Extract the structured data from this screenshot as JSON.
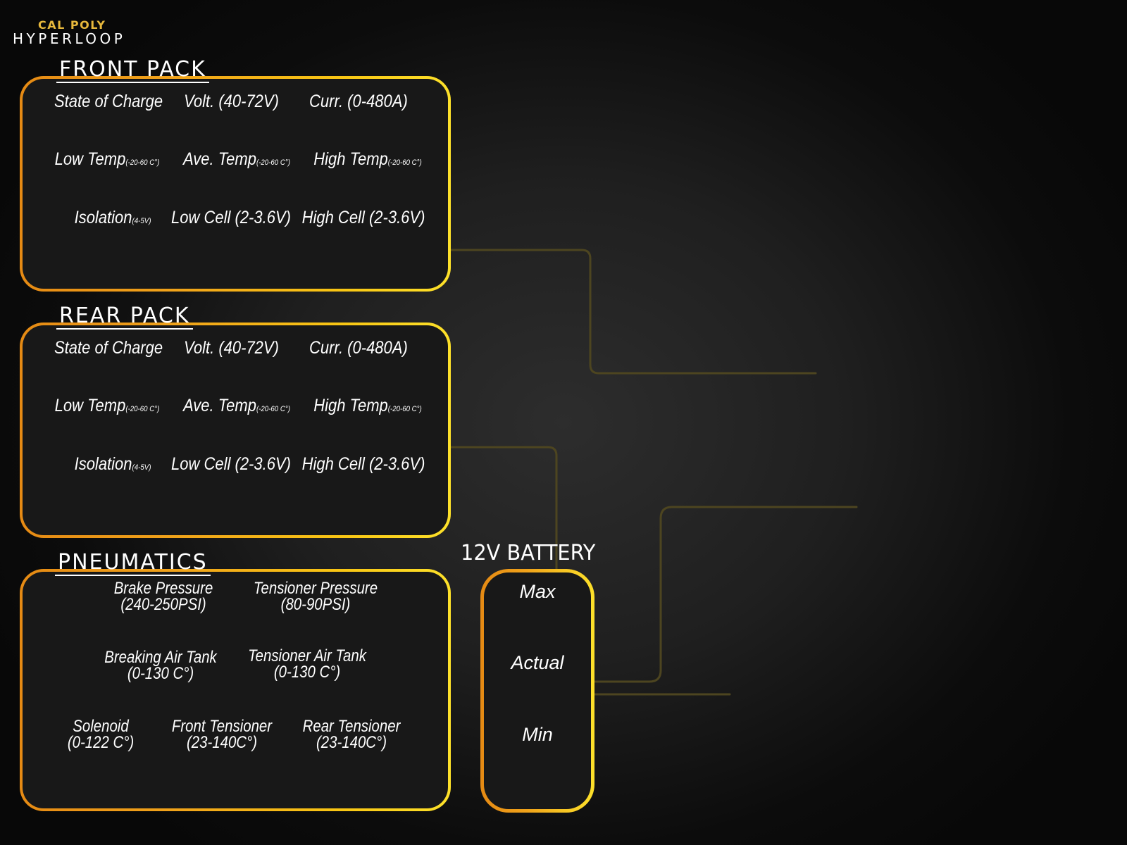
{
  "logo": {
    "top": "CAL POLY",
    "bottom": "HYPERLOOP"
  },
  "front_pack": {
    "title": "FRONT PACK",
    "row1": [
      "State of Charge",
      "Volt. (40-72V)",
      "Curr. (0-480A)"
    ],
    "row2": [
      {
        "main": "Low Temp",
        "sub": "(-20-60 C°)"
      },
      {
        "main": "Ave. Temp",
        "sub": "(-20-60 C°)"
      },
      {
        "main": "High Temp",
        "sub": "(-20-60 C°)"
      }
    ],
    "row3": [
      {
        "main": "Isolation",
        "sub": "(4-5V)"
      },
      {
        "main": "Low Cell (2-3.6V)",
        "sub": ""
      },
      {
        "main": "High Cell (2-3.6V)",
        "sub": ""
      }
    ]
  },
  "rear_pack": {
    "title": "REAR PACK",
    "row1": [
      "State of Charge",
      "Volt. (40-72V)",
      "Curr. (0-480A)"
    ],
    "row2": [
      {
        "main": "Low Temp",
        "sub": "(-20-60 C°)"
      },
      {
        "main": "Ave. Temp",
        "sub": "(-20-60 C°)"
      },
      {
        "main": "High Temp",
        "sub": "(-20-60 C°)"
      }
    ],
    "row3": [
      {
        "main": "Isolation",
        "sub": "(4-5V)"
      },
      {
        "main": "Low Cell (2-3.6V)",
        "sub": ""
      },
      {
        "main": "High Cell (2-3.6V)",
        "sub": ""
      }
    ]
  },
  "pneumatics": {
    "title": "PNEUMATICS",
    "brake_pressure": [
      "Brake Pressure",
      "(240-250PSI)"
    ],
    "tensioner_pressure": [
      "Tensioner Pressure",
      "(80-90PSI)"
    ],
    "breaking_air_tank": [
      "Breaking Air Tank",
      "(0-130 C°)"
    ],
    "tensioner_air_tank": [
      "Tensioner Air Tank",
      "(0-130 C°)"
    ],
    "solenoid": [
      "Solenoid",
      "(0-122 C°)"
    ],
    "front_tensioner": [
      "Front Tensioner",
      "(23-140C°)"
    ],
    "rear_tensioner": [
      "Rear Tensioner",
      "(23-140C°)"
    ]
  },
  "battery_12v": {
    "title": "12V BATTERY",
    "max": "Max",
    "actual": "Actual",
    "min": "Min"
  },
  "colors": {
    "accent_orange": "#e58a14",
    "accent_yellow": "#fde12a",
    "logo_gold": "#e7b83c"
  }
}
